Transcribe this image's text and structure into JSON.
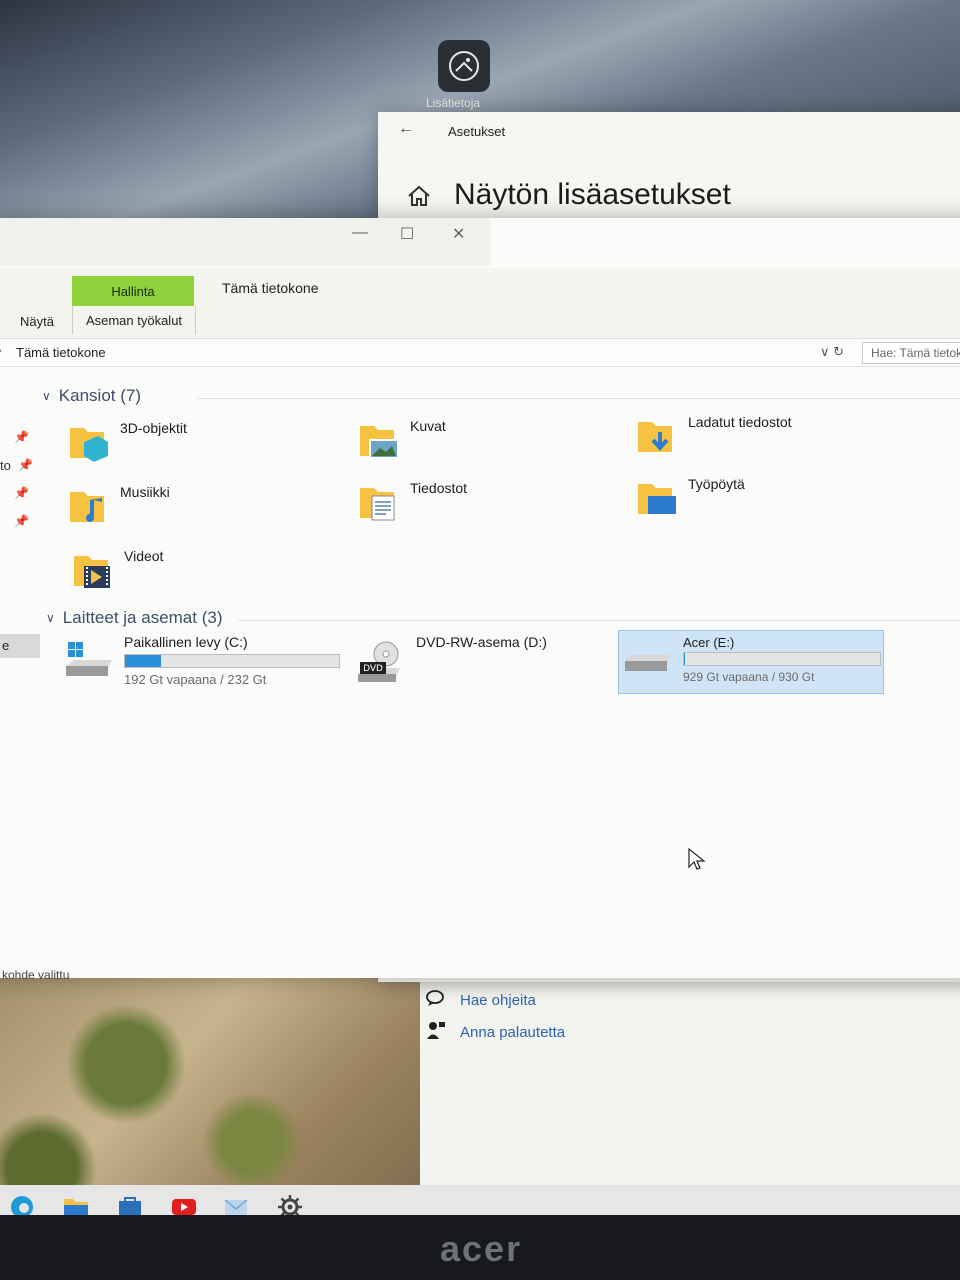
{
  "desktop": {
    "info_button_label": "Lisätietoja"
  },
  "settings": {
    "app_title": "Asetukset",
    "page_title": "Näytön lisäasetukset",
    "help_links": [
      {
        "label": "Hae ohjeita",
        "icon": "help-chat-icon"
      },
      {
        "label": "Anna palautetta",
        "icon": "feedback-icon"
      }
    ]
  },
  "explorer": {
    "ribbon": {
      "contextual_group": "Hallinta",
      "contextual_tab": "Aseman työkalut",
      "tab_computer": "Tämä tietokone",
      "tab_view": "Näytä"
    },
    "address": {
      "path": "Tämä tietokone",
      "search_placeholder": "Hae: Tämä tietokone"
    },
    "nav_pane": {
      "partial_label": "to",
      "partial_label2": "e"
    },
    "folders_header": "Kansiot (7)",
    "folders": [
      {
        "name": "3D-objektit",
        "icon": "3d-objects-folder-icon"
      },
      {
        "name": "Kuvat",
        "icon": "pictures-folder-icon"
      },
      {
        "name": "Ladatut tiedostot",
        "icon": "downloads-folder-icon"
      },
      {
        "name": "Musiikki",
        "icon": "music-folder-icon"
      },
      {
        "name": "Tiedostot",
        "icon": "documents-folder-icon"
      },
      {
        "name": "Työpöytä",
        "icon": "desktop-folder-icon"
      },
      {
        "name": "Videot",
        "icon": "videos-folder-icon"
      }
    ],
    "drives_header": "Laitteet ja asemat (3)",
    "drives": [
      {
        "name": "Paikallinen levy (C:)",
        "capacity": "192 Gt vapaana / 232 Gt",
        "used_fraction": 0.17,
        "icon": "windows-drive-icon"
      },
      {
        "name": "DVD-RW-asema (D:)",
        "capacity": "",
        "badge": "DVD",
        "icon": "dvd-drive-icon"
      },
      {
        "name": "Acer (E:)",
        "capacity": "929 Gt vapaana / 930 Gt",
        "used_fraction": 0.001,
        "icon": "external-drive-icon"
      }
    ],
    "status": "kohde valittu"
  },
  "brand": {
    "logo_text": "acer"
  },
  "colors": {
    "ribbon_accent": "#8ed13a",
    "drive_fill": "#2a8fd9",
    "link_blue": "#2d64b3"
  }
}
